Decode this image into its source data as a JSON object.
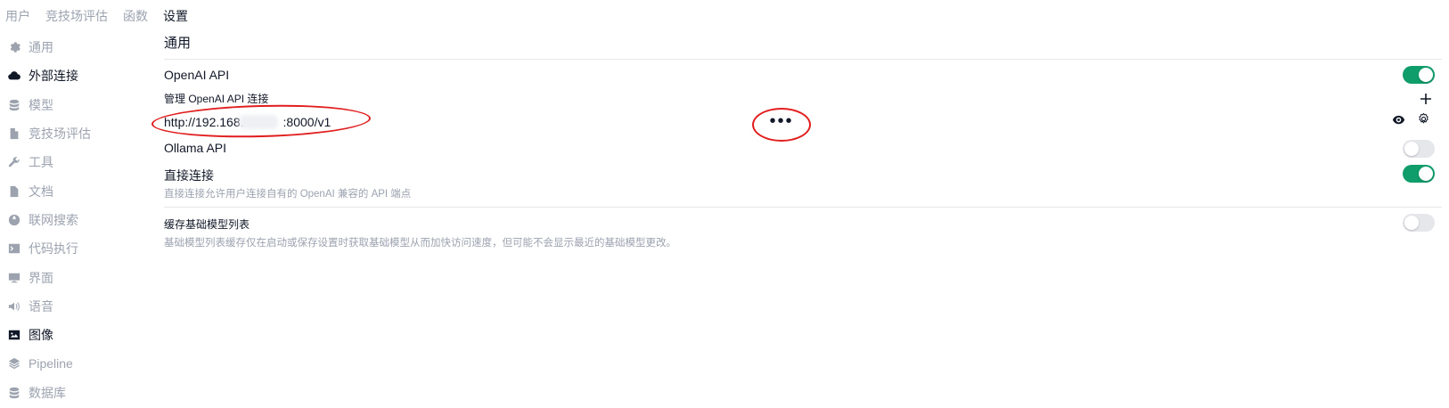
{
  "topnav": {
    "tabs": [
      {
        "label": "用户"
      },
      {
        "label": "竞技场评估"
      },
      {
        "label": "函数"
      },
      {
        "label": "设置"
      }
    ],
    "active_index": 3
  },
  "sidebar": {
    "items": [
      {
        "label": "通用",
        "icon": "gear-icon"
      },
      {
        "label": "外部连接",
        "icon": "cloud-icon"
      },
      {
        "label": "模型",
        "icon": "database-icon"
      },
      {
        "label": "竞技场评估",
        "icon": "document-icon"
      },
      {
        "label": "工具",
        "icon": "wrench-icon"
      },
      {
        "label": "文档",
        "icon": "doc-icon"
      },
      {
        "label": "联网搜索",
        "icon": "globe-icon"
      },
      {
        "label": "代码执行",
        "icon": "terminal-icon"
      },
      {
        "label": "界面",
        "icon": "monitor-icon"
      },
      {
        "label": "语音",
        "icon": "speaker-icon"
      },
      {
        "label": "图像",
        "icon": "image-icon"
      },
      {
        "label": "Pipeline",
        "icon": "layers-icon"
      },
      {
        "label": "数据库",
        "icon": "database-icon"
      }
    ],
    "active_indices": [
      1,
      10
    ]
  },
  "main": {
    "section_title": "通用",
    "openai": {
      "label": "OpenAI API",
      "enabled": true,
      "manage_label": "管理 OpenAI API 连接",
      "connection_url_prefix": "http://192.168.",
      "connection_url_suffix": ":8000/v1",
      "more_label": "•••"
    },
    "ollama": {
      "label": "Ollama API",
      "enabled": false
    },
    "direct": {
      "label": "直接连接",
      "enabled": true,
      "description": "直接连接允许用户连接自有的 OpenAI 兼容的 API 端点"
    },
    "cache": {
      "label": "缓存基础模型列表",
      "enabled": false,
      "description": "基础模型列表缓存仅在启动或保存设置时获取基础模型从而加快访问速度，但可能不会显示最近的基础模型更改。"
    }
  },
  "colors": {
    "toggle_on": "#0f9d6b",
    "toggle_off": "#e5e7eb",
    "annotation_red": "#e11d1d"
  }
}
